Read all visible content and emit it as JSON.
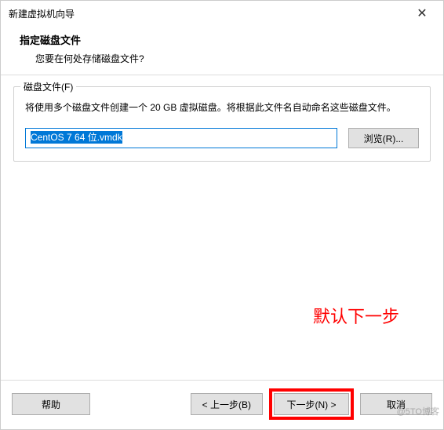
{
  "titlebar": {
    "title": "新建虚拟机向导",
    "close_glyph": "✕"
  },
  "header": {
    "heading": "指定磁盘文件",
    "subheading": "您要在何处存储磁盘文件?"
  },
  "group": {
    "title": "磁盘文件(F)",
    "description": "将使用多个磁盘文件创建一个 20 GB 虚拟磁盘。将根据此文件名自动命名这些磁盘文件。",
    "file_value": "CentOS 7 64 位.vmdk",
    "browse_label": "浏览(R)..."
  },
  "annotation": {
    "text": "默认下一步"
  },
  "footer": {
    "help": "帮助",
    "back": "< 上一步(B)",
    "next": "下一步(N) >",
    "cancel": "取消"
  },
  "watermark": "@5TO博客"
}
